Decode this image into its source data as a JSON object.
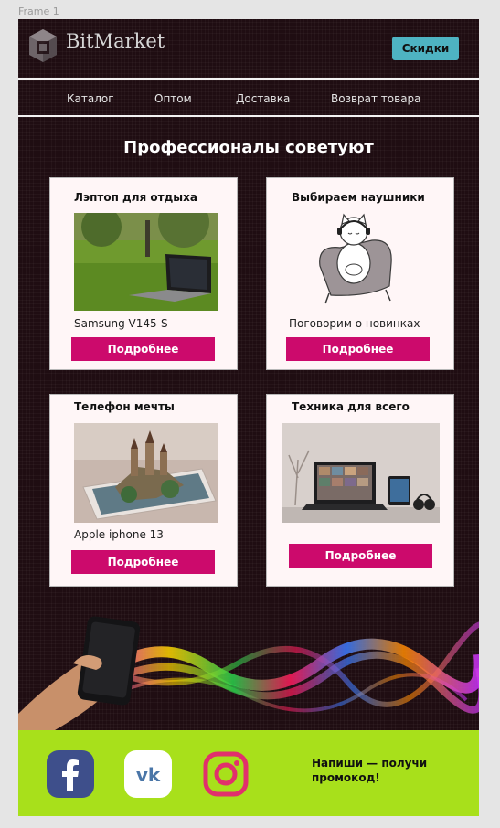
{
  "frame_label": "Frame 1",
  "brand": "BitMarket",
  "header": {
    "sale_button": "Скидки"
  },
  "nav": [
    "Каталог",
    "Оптом",
    "Доставка",
    "Возврат товара"
  ],
  "section_title": "Профессионалы советуют",
  "cards": [
    {
      "title": "Лэптоп для отдыха",
      "caption": "Samsung V145-S",
      "button": "Подробнее",
      "image": "laptop-on-grass"
    },
    {
      "title": "Выбираем наушники",
      "caption": "Поговорим о новинках",
      "button": "Подробнее",
      "image": "cat-with-headphones"
    },
    {
      "title": "Телефон мечты",
      "caption": "Apple iphone 13",
      "button": "Подробнее",
      "image": "castle-on-phone"
    },
    {
      "title": "Техника для всего",
      "caption": "",
      "button": "Подробнее",
      "image": "laptop-tablet-headphones"
    }
  ],
  "footer": {
    "socials": [
      "facebook-icon",
      "vk-icon",
      "instagram-icon"
    ],
    "promo": "Напиши — получи промокод!"
  },
  "colors": {
    "frame_bg": "#1f0d12",
    "accent_button": "#cc0a6c",
    "sale_button": "#4eb3c2",
    "footer_bg": "#a8e01b"
  }
}
